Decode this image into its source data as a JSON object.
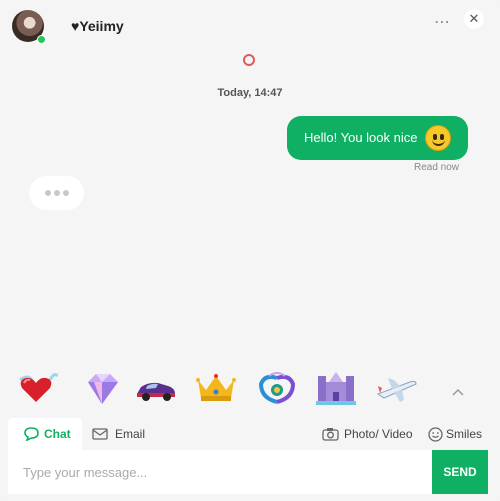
{
  "header": {
    "user_name": "♥Yeiimy",
    "more_icon": "⋯",
    "close_icon": "✕"
  },
  "conversation": {
    "date_stamp": "Today, 14:47",
    "outgoing_message": "Hello! You look nice",
    "read_status": "Read now"
  },
  "gifts": [
    "heart-with-wings",
    "diamond",
    "sports-car",
    "crown",
    "peacock",
    "castle",
    "airplane"
  ],
  "tabs": {
    "chat": "Chat",
    "email": "Email",
    "photo_video": "Photo/ Video",
    "smiles": "Smiles"
  },
  "composer": {
    "placeholder": "Type your message...",
    "send_label": "SEND"
  },
  "colors": {
    "accent": "#10b064",
    "online": "#22c55e",
    "background": "#f5f5f5"
  }
}
